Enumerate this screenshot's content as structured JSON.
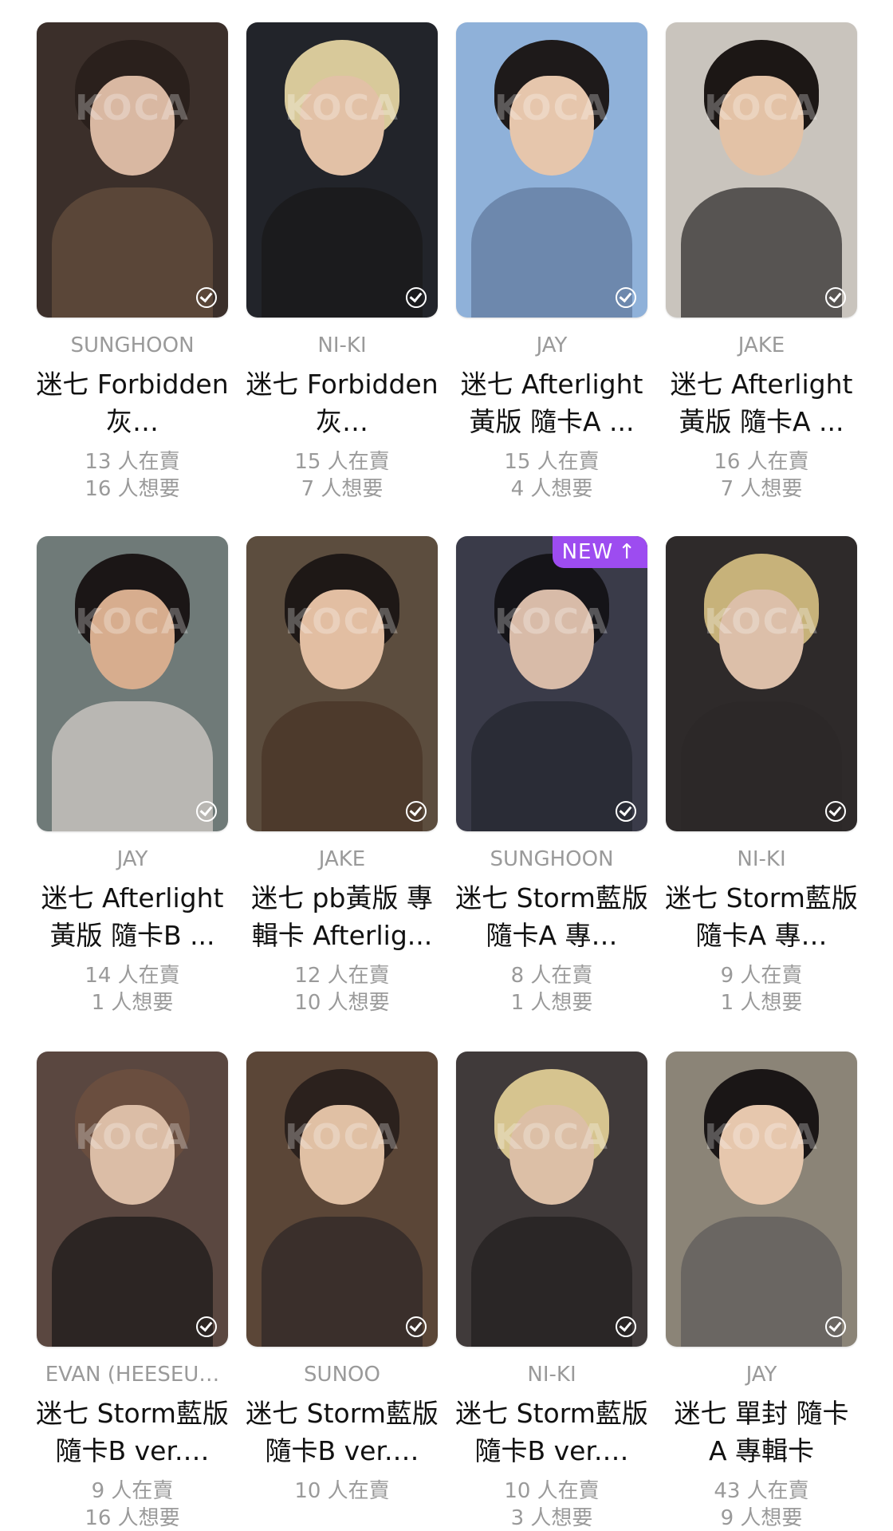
{
  "watermark": "KOCA",
  "cards": [
    {
      "member": "SUNGHOON",
      "title": "迷七 Forbidden灰…",
      "selling": "13 人在賣",
      "wanting": "16 人想要",
      "bg": "#3b2f2a",
      "skin": "#d9b8a2",
      "hair": "#2a201c",
      "top": "#5a4638"
    },
    {
      "member": "NI-KI",
      "title": "迷七 Forbidden灰…",
      "selling": "15 人在賣",
      "wanting": "7 人想要",
      "bg": "#22242a",
      "skin": "#e2c1a6",
      "hair": "#d8c99a",
      "top": "#1b1b1d"
    },
    {
      "member": "JAY",
      "title": "迷七 Afterlight 黃版 隨卡A ...",
      "selling": "15 人在賣",
      "wanting": "4 人想要",
      "bg": "#8fb1d9",
      "skin": "#e6c6ac",
      "hair": "#1e1a1a",
      "top": "#6d88ad"
    },
    {
      "member": "JAKE",
      "title": "迷七 Afterlight 黃版 隨卡A ...",
      "selling": "16 人在賣",
      "wanting": "7 人想要",
      "bg": "#c9c4bd",
      "skin": "#e3c2a6",
      "hair": "#1c1715",
      "top": "#575452"
    },
    {
      "member": "JAY",
      "title": "迷七 Afterlight 黃版 隨卡B ...",
      "selling": "14 人在賣",
      "wanting": "1 人想要",
      "bg": "#6f7a78",
      "skin": "#d7ad8e",
      "hair": "#1b1616",
      "top": "#b9b7b3"
    },
    {
      "member": "JAKE",
      "title": "迷七 pb黃版 專輯卡 Afterlig...",
      "selling": "12 人在賣",
      "wanting": "10 人想要",
      "bg": "#5c4d3e",
      "skin": "#e2bea2",
      "hair": "#1e1816",
      "top": "#4d3a2c"
    },
    {
      "member": "SUNGHOON",
      "title": "迷七 Storm藍版 隨卡A 專…",
      "selling": "8 人在賣",
      "wanting": "1 人想要",
      "bg": "#3a3b49",
      "skin": "#d8bba8",
      "hair": "#151418",
      "top": "#2a2c36",
      "badge": "NEW"
    },
    {
      "member": "NI-KI",
      "title": "迷七 Storm藍版 隨卡A 專…",
      "selling": "9 人在賣",
      "wanting": "1 人想要",
      "bg": "#2e2a2a",
      "skin": "#dcbfa9",
      "hair": "#c7b27a",
      "top": "#2c2828"
    },
    {
      "member": "EVAN (HEESEU…",
      "title": "迷七 Storm藍版 隨卡B ver.…",
      "selling": "9 人在賣",
      "wanting": "16 人想要",
      "bg": "#5a4740",
      "skin": "#dbbda6",
      "hair": "#6a4e3f",
      "top": "#2c2523"
    },
    {
      "member": "SUNOO",
      "title": "迷七 Storm藍版 隨卡B ver.…",
      "selling": "10 人在賣",
      "wanting": "",
      "bg": "#5b4637",
      "skin": "#e0c0a4",
      "hair": "#2b211d",
      "top": "#3a2f2b"
    },
    {
      "member": "NI-KI",
      "title": "迷七 Storm藍版 隨卡B ver.…",
      "selling": "10 人在賣",
      "wanting": "3 人想要",
      "bg": "#403a3a",
      "skin": "#dcbfa6",
      "hair": "#d6c48f",
      "top": "#2a2626"
    },
    {
      "member": "JAY",
      "title": "迷七 單封 隨卡 A 專輯卡",
      "selling": "43 人在賣",
      "wanting": "9 人想要",
      "bg": "#8b8477",
      "skin": "#e6c7ad",
      "hair": "#1a1616",
      "top": "#6a6662"
    }
  ],
  "icons": {
    "check": "check-circle-icon",
    "new_arrow": "arrow-up-icon"
  },
  "colors": {
    "badge": "#9d4cf0",
    "muted": "#9a9a9a",
    "title": "#111111"
  }
}
